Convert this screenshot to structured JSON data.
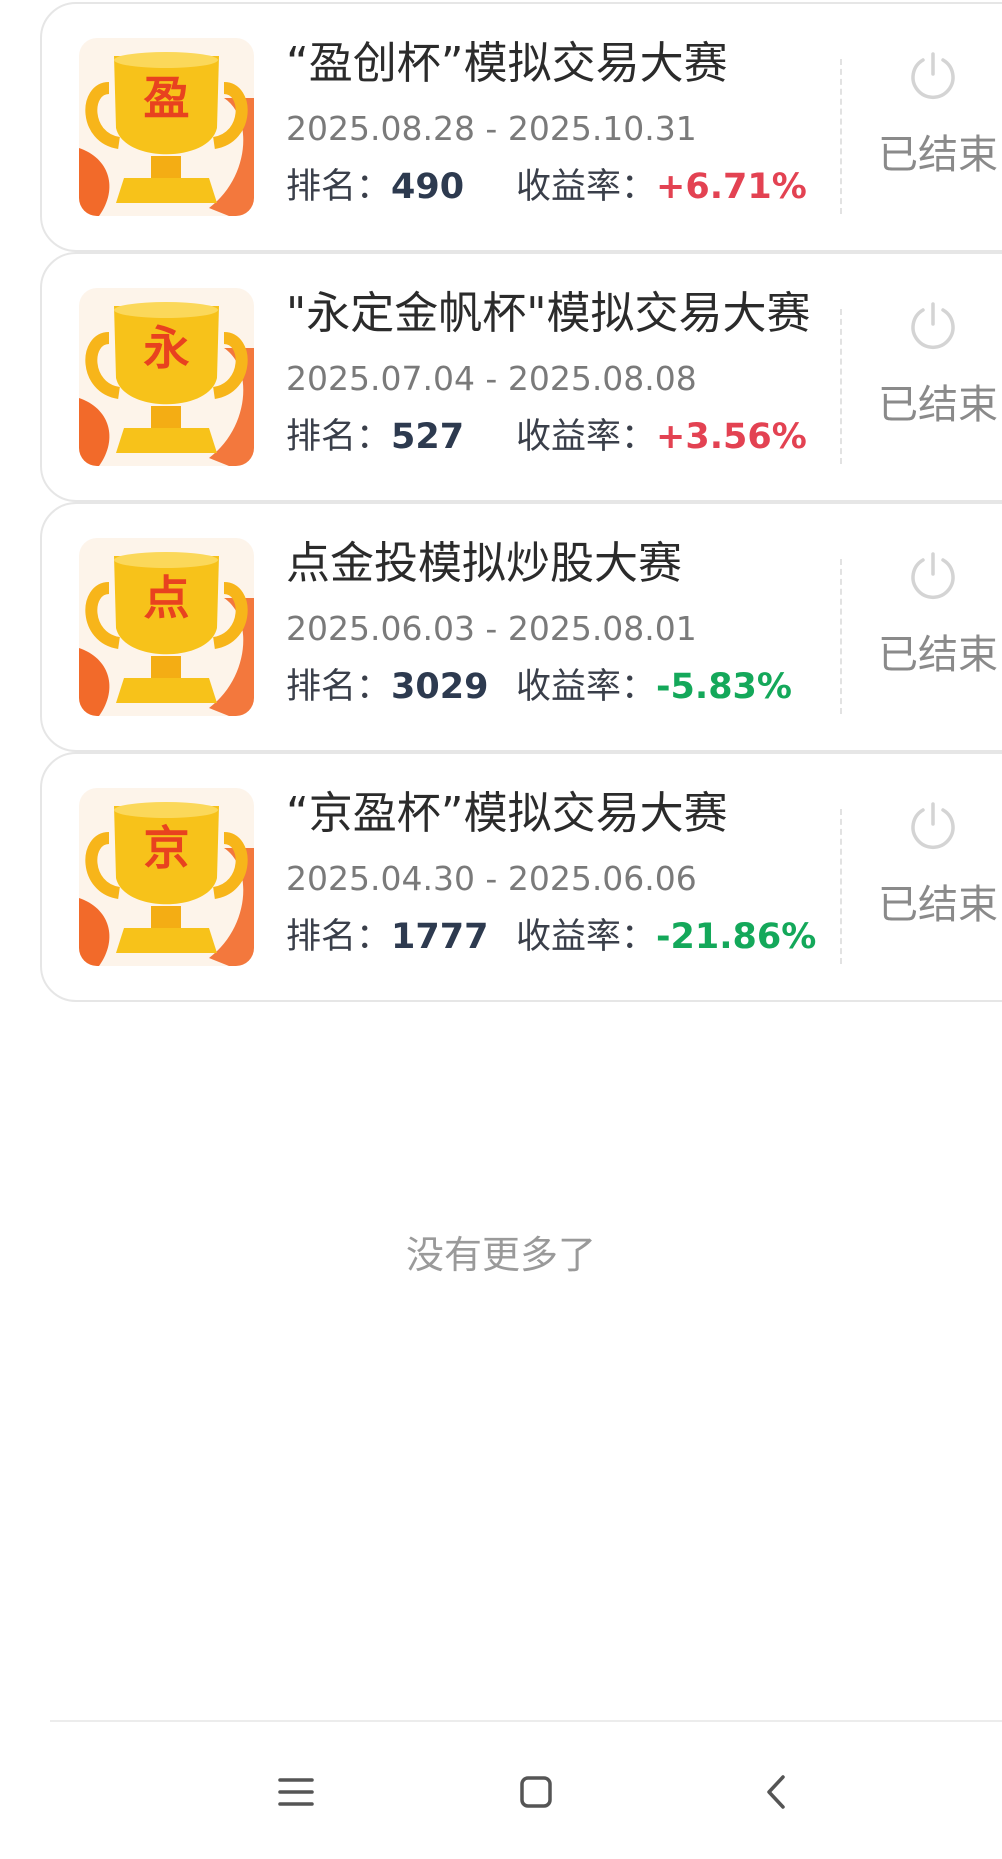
{
  "contests": [
    {
      "badge_char": "盈",
      "title": "“盈创杯”模拟交易大赛",
      "dates": "2025.08.28 - 2025.10.31",
      "rank_label": "排名：",
      "rank": "490",
      "return_label": "收益率：",
      "return": "+6.71%",
      "return_color": "#e34252",
      "status": "已结束"
    },
    {
      "badge_char": "永",
      "title": "\"永定金帆杯\"模拟交易大赛",
      "dates": "2025.07.04 - 2025.08.08",
      "rank_label": "排名：",
      "rank": "527",
      "return_label": "收益率：",
      "return": "+3.56%",
      "return_color": "#e34252",
      "status": "已结束"
    },
    {
      "badge_char": "点",
      "title": "点金投模拟炒股大赛",
      "dates": "2025.06.03 - 2025.08.01",
      "rank_label": "排名：",
      "rank": "3029",
      "return_label": "收益率：",
      "return": "-5.83%",
      "return_color": "#14a85a",
      "status": "已结束"
    },
    {
      "badge_char": "京",
      "title": "“京盈杯”模拟交易大赛",
      "dates": "2025.04.30 - 2025.06.06",
      "rank_label": "排名：",
      "rank": "1777",
      "return_label": "收益率：",
      "return": "-21.86%",
      "return_color": "#14a85a",
      "status": "已结束"
    }
  ],
  "list_footer": "没有更多了",
  "icons": {
    "trophy": "trophy-icon",
    "status": "power-icon",
    "nav_menu": "menu-icon",
    "nav_home": "home-icon",
    "nav_back": "back-icon"
  },
  "colors": {
    "positive_return": "#e34252",
    "negative_return": "#14a85a",
    "trophy_gold": "#f7c21a",
    "trophy_orange": "#f26a2a"
  }
}
